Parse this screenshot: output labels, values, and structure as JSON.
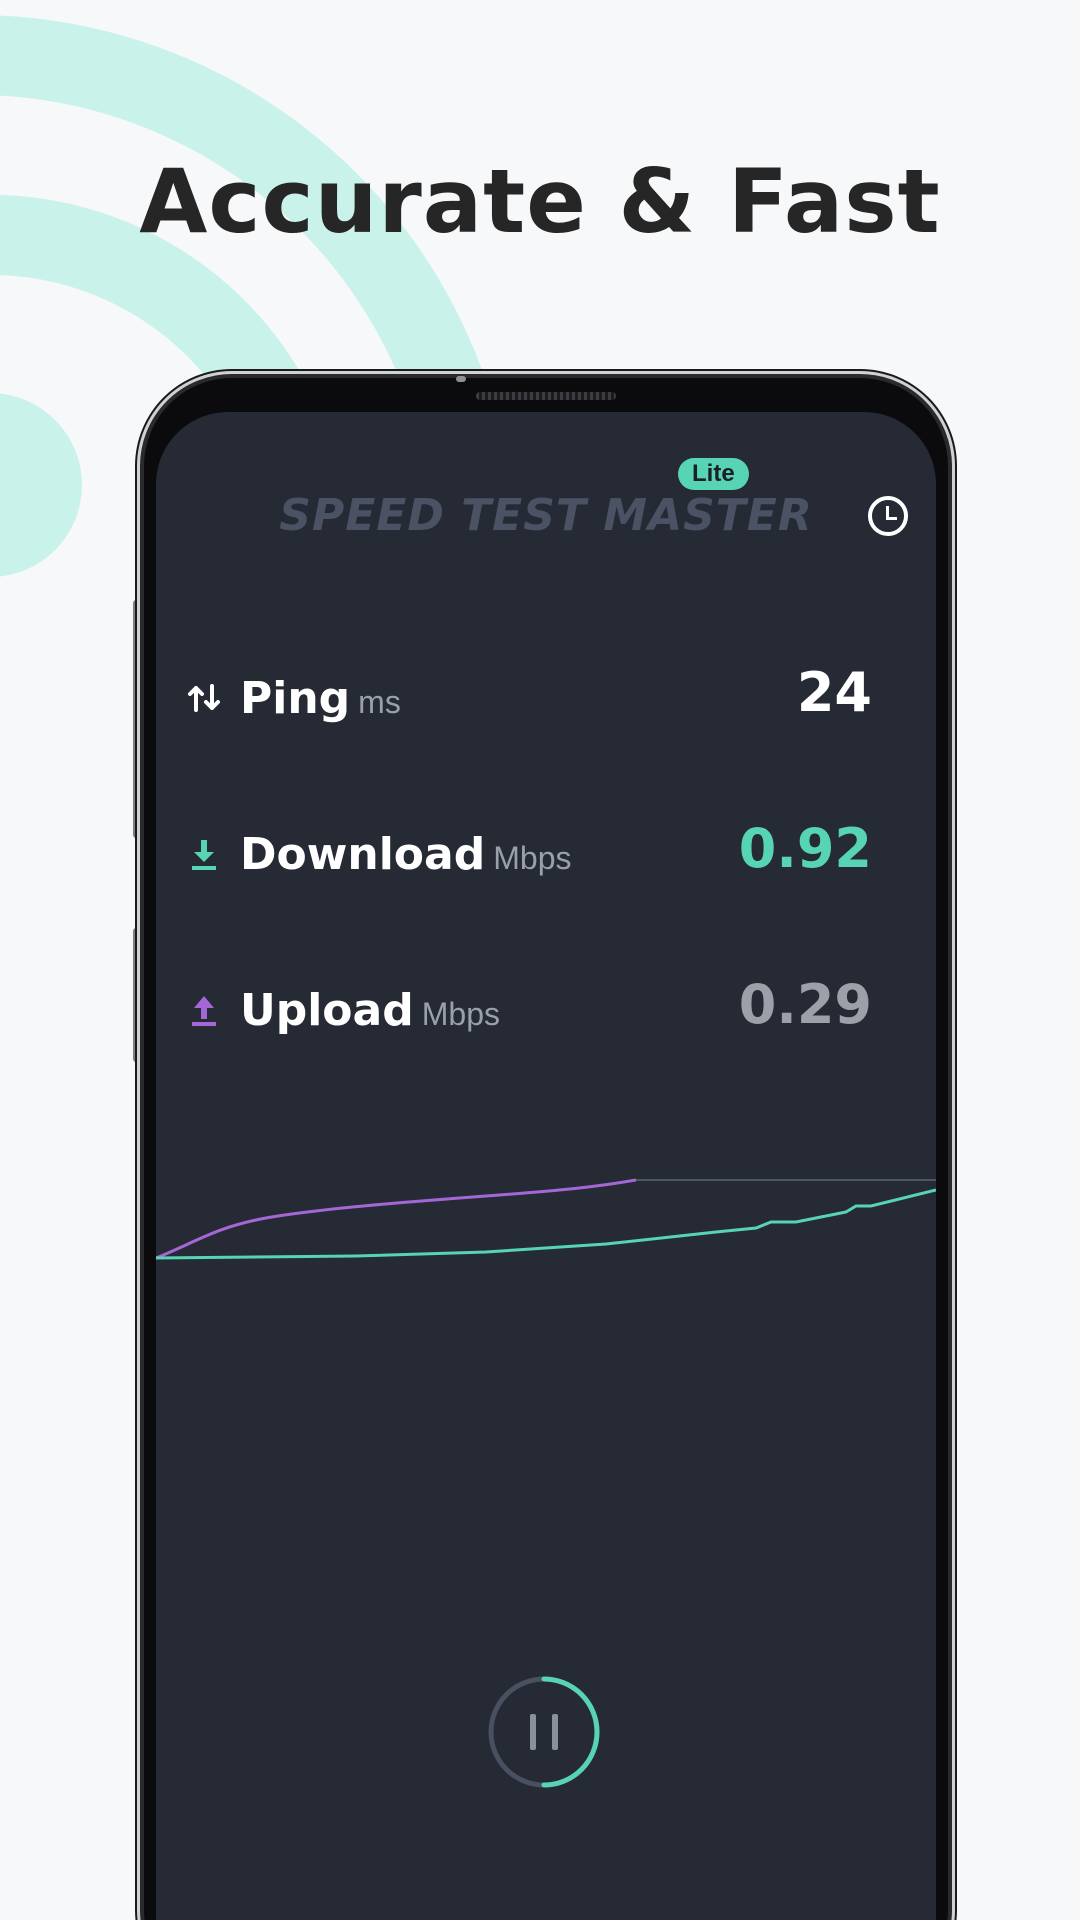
{
  "headline": "Accurate & Fast",
  "app": {
    "logo_text": "SPEED TEST MASTER",
    "badge": "Lite",
    "history_icon": "clock-icon"
  },
  "metrics": [
    {
      "label": "Ping",
      "unit": "ms",
      "value": "24",
      "icon": "ping-arrows-icon"
    },
    {
      "label": "Download",
      "unit": "Mbps",
      "value": "0.92",
      "icon": "download-icon"
    },
    {
      "label": "Upload",
      "unit": "Mbps",
      "value": "0.29",
      "icon": "upload-icon"
    }
  ],
  "colors": {
    "background": "#f7f8f9",
    "headline": "#262626",
    "screen": "#252a35",
    "accent_teal": "#57d4b3",
    "accent_purple": "#a566d6",
    "value_white": "#ffffff",
    "value_gray": "#9ba0a9",
    "decor_mint": "#c9f3ea"
  },
  "progress": {
    "pause_ring_fraction": 0.5
  },
  "pause_icon": "pause-icon"
}
